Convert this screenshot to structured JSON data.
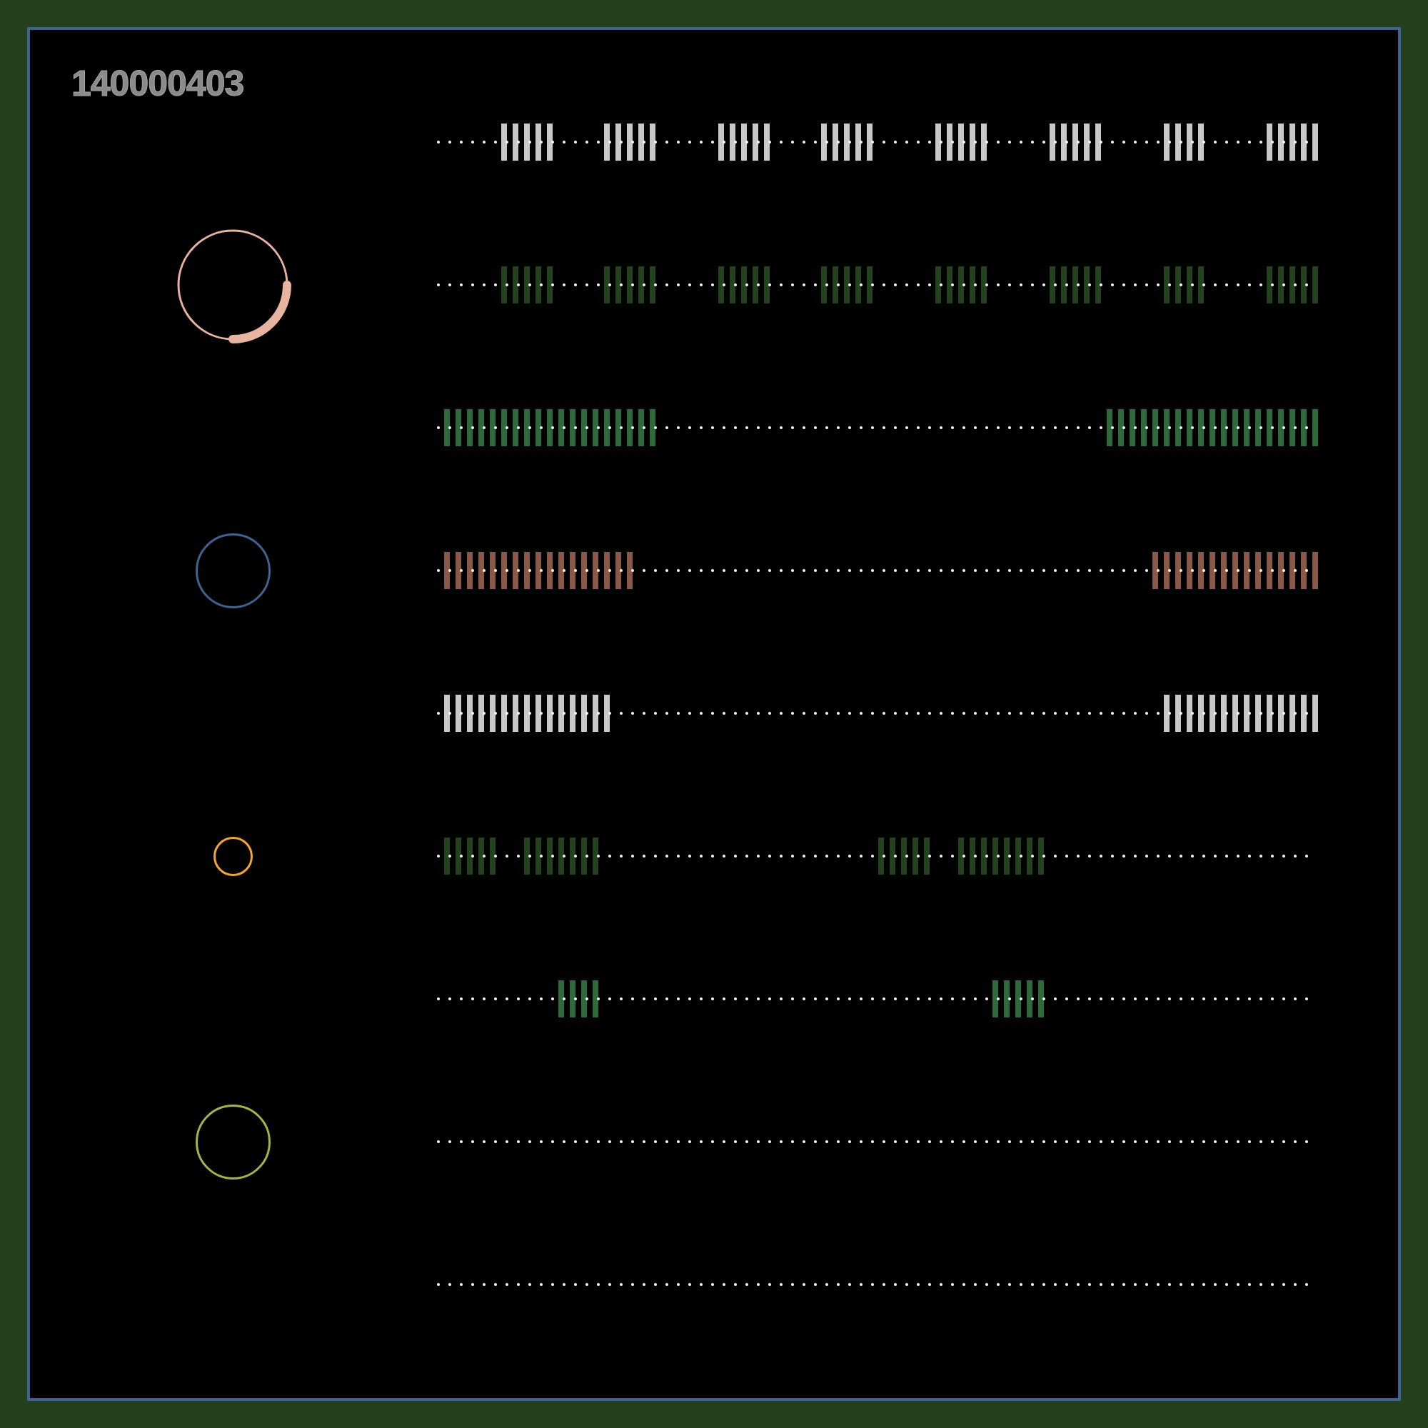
{
  "title": "140000403",
  "rows": [
    {
      "color": "#c8c8c8"
    },
    {
      "color": "#24421e",
      "ring": {
        "kind": "accented",
        "color": "#e8b4a0"
      }
    },
    {
      "color": "#2f6b3a"
    },
    {
      "color": "#8a5a48",
      "ring": {
        "kind": "plain",
        "color": "#3f6391"
      }
    },
    {
      "color": "#c8c8c8"
    },
    {
      "color": "#24421e",
      "ring": {
        "kind": "plain",
        "color": "#f5a623"
      }
    },
    {
      "color": "#2f6b3a"
    },
    {
      "ring": {
        "kind": "plain",
        "color": "#a8b43c"
      }
    },
    {}
  ]
}
